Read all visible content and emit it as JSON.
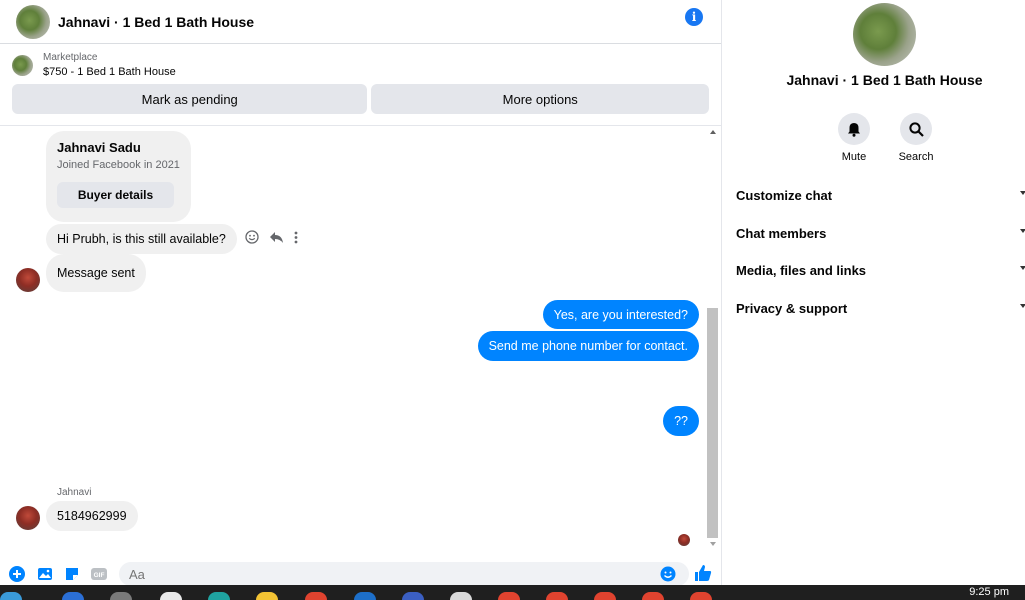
{
  "header": {
    "title": "Jahnavi · 1 Bed 1 Bath House",
    "info_icon": "info-icon"
  },
  "listing": {
    "label": "Marketplace",
    "name": "$750 - 1 Bed 1 Bath House",
    "buttons": [
      "Mark as pending",
      "More options"
    ]
  },
  "thread": {
    "card": {
      "name": "Jahnavi Sadu",
      "subtitle": "Joined Facebook in 2021",
      "button": "Buyer details"
    },
    "messages": [
      {
        "from": "them",
        "text": "Hi Prubh, is this still available?"
      },
      {
        "from": "them",
        "text": "Message sent"
      },
      {
        "from": "me",
        "text": "Yes, are you interested?"
      },
      {
        "from": "me",
        "text": "Send me phone number for contact."
      },
      {
        "from": "me",
        "text": "??"
      },
      {
        "from": "them",
        "text": "5184962999"
      }
    ],
    "sender_label": "Jahnavi"
  },
  "composer": {
    "placeholder": "Aa"
  },
  "side": {
    "title": "Jahnavi · 1 Bed 1 Bath House",
    "actions": [
      {
        "label": "Mute",
        "icon": "bell-icon"
      },
      {
        "label": "Search",
        "icon": "search-icon"
      }
    ],
    "menu": [
      "Customize chat",
      "Chat members",
      "Media, files and links",
      "Privacy & support"
    ]
  },
  "taskbar": {
    "time": "9:25 pm"
  },
  "colors": {
    "accent": "#0084ff",
    "brand": "#1877f2",
    "bubble_in": "#f0f0f0"
  }
}
